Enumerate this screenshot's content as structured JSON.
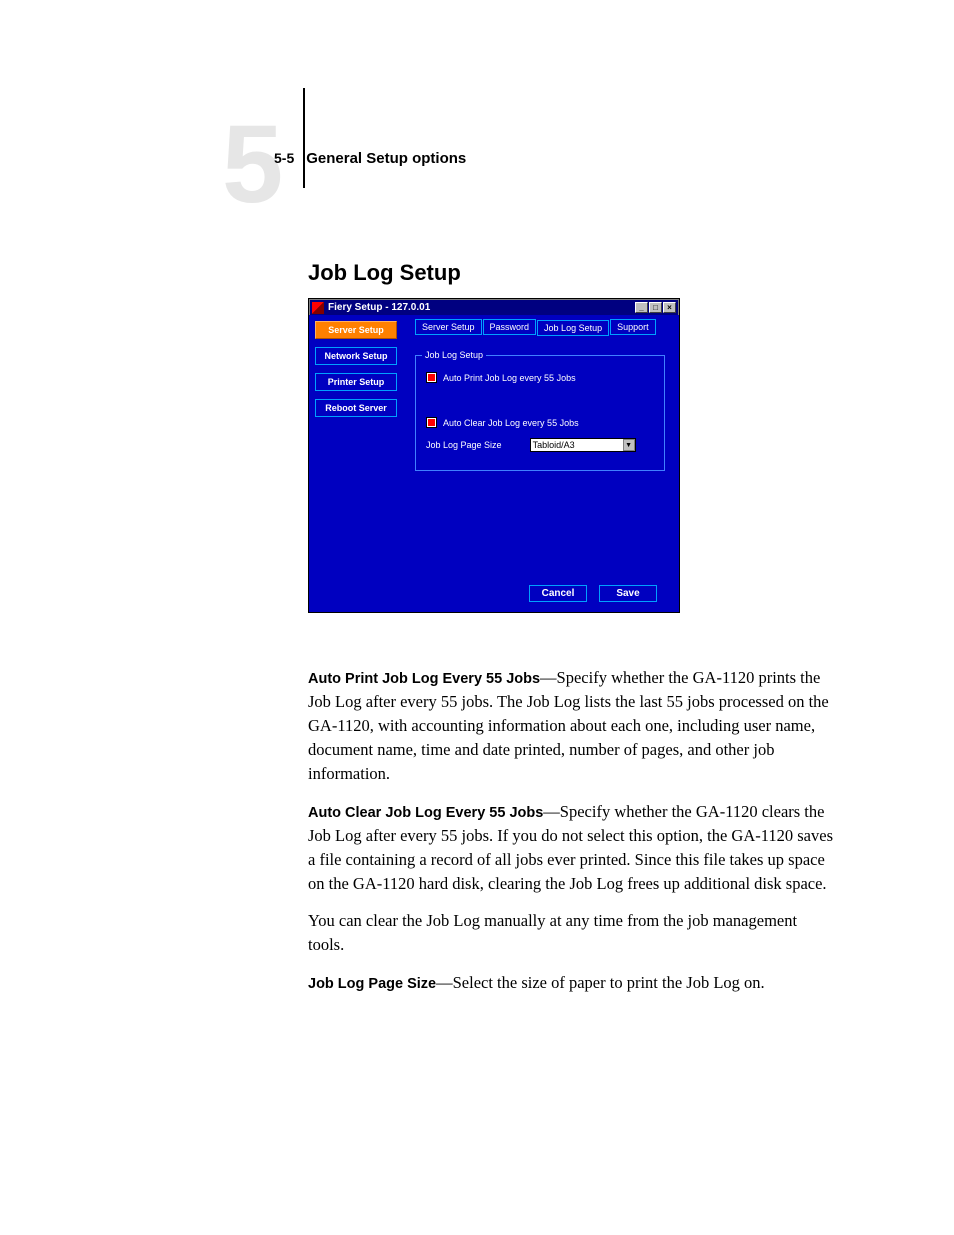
{
  "header": {
    "chapter_number": "5",
    "page_ref": "5-5",
    "running_title": "General Setup options"
  },
  "section_title": "Job Log Setup",
  "window": {
    "title": "Fiery Setup - 127.0.01",
    "min": "_",
    "max": "□",
    "close": "×",
    "sidebar": {
      "server_setup": "Server Setup",
      "network_setup": "Network Setup",
      "printer_setup": "Printer Setup",
      "reboot_server": "Reboot Server"
    },
    "tabs": {
      "server_setup": "Server Setup",
      "password": "Password",
      "job_log_setup": "Job Log Setup",
      "support": "Support"
    },
    "panel": {
      "legend": "Job Log Setup",
      "auto_print_label": "Auto Print Job Log every 55 Jobs",
      "auto_clear_label": "Auto Clear Job Log every 55 Jobs",
      "page_size_label": "Job Log Page Size",
      "page_size_value": "Tabloid/A3"
    },
    "footer": {
      "cancel": "Cancel",
      "save": "Save"
    }
  },
  "body": {
    "p1_bold": "Auto Print Job Log Every 55 Jobs",
    "p1_rest": "—Specify whether the GA-1120 prints the Job Log after every 55 jobs. The Job Log lists the last 55 jobs processed on the GA-1120, with accounting information about each one, including user name, document name, time and date printed, number of pages, and other job information.",
    "p2_bold": "Auto Clear Job Log Every 55 Jobs",
    "p2_rest": "—Specify whether the GA-1120 clears the Job Log after every 55 jobs. If you do not select this option, the GA-1120 saves a file containing a record of all jobs ever printed. Since this file takes up space on the GA-1120 hard disk, clearing the Job Log frees up additional disk space.",
    "p3": "You can clear the Job Log manually at any time from the job management tools.",
    "p4_bold": "Job Log Page Size",
    "p4_rest": "—Select the size of paper to print the Job Log on."
  }
}
